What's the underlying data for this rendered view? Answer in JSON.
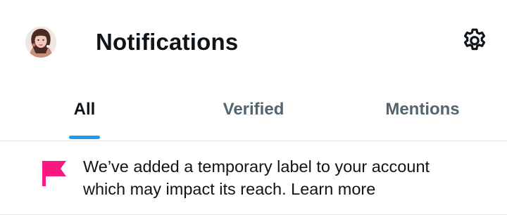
{
  "header": {
    "title": "Notifications",
    "avatar_icon": "user-avatar",
    "settings_icon": "gear-icon"
  },
  "tabs": [
    {
      "label": "All",
      "active": true
    },
    {
      "label": "Verified",
      "active": false
    },
    {
      "label": "Mentions",
      "active": false
    }
  ],
  "notice": {
    "icon": "flag-icon",
    "text_line1": "We’ve added a temporary label to your account",
    "text_line2": "which may impact its reach.",
    "link": "Learn more"
  },
  "colors": {
    "accent": "#1d9bf0",
    "flag": "#f91880",
    "text_primary": "#0f1419",
    "text_secondary": "#536471"
  }
}
